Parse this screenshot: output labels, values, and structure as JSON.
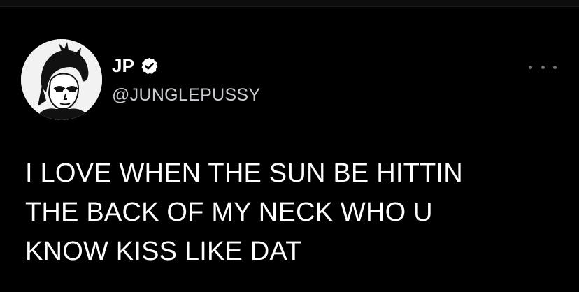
{
  "author": {
    "display_name": "JP",
    "handle": "@JUNGLEPUSSY",
    "avatar_icon": "profile-avatar",
    "verified_icon": "verified-badge-icon"
  },
  "menu": {
    "icon": "more-options-icon"
  },
  "tweet": {
    "lines": [
      "I LOVE WHEN THE SUN BE HITTIN",
      "THE BACK OF MY NECK WHO U",
      "KNOW KISS LIKE DAT"
    ]
  },
  "colors": {
    "background": "#000000",
    "text": "#ffffff",
    "handle": "#c9cdd1",
    "menu_dots": "#6e767d"
  }
}
